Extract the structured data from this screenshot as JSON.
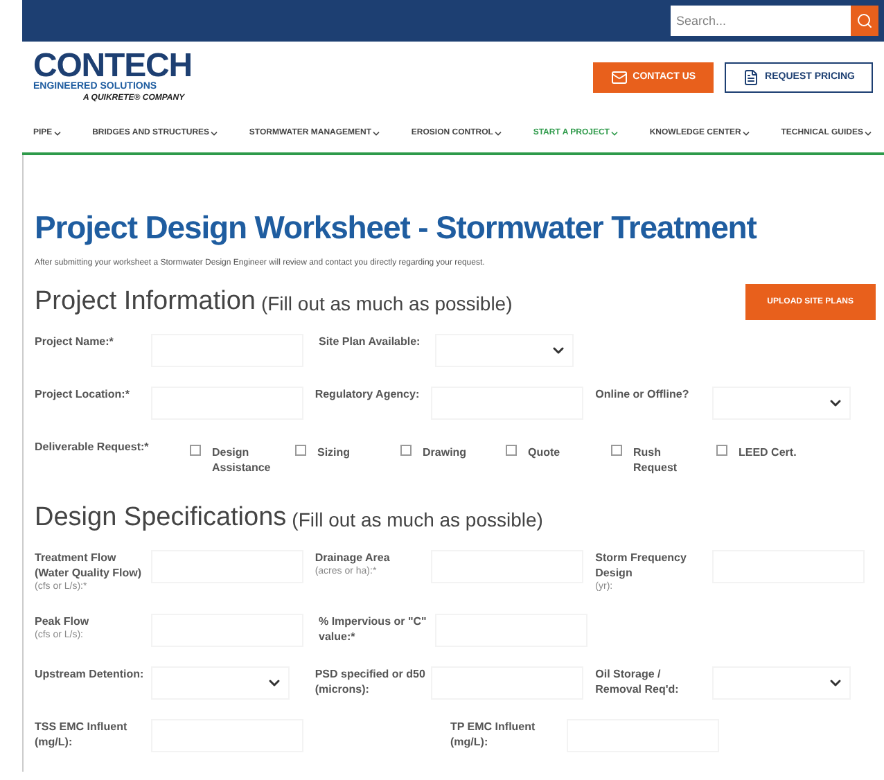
{
  "topbar": {
    "search": {
      "placeholder": "Search..."
    }
  },
  "logo": {
    "name": "CONTECH",
    "subtitle": "ENGINEERED SOLUTIONS",
    "tagline": "A QUIKRETE® COMPANY"
  },
  "header_buttons": [
    {
      "label": "CONTACT US",
      "kind": "primary"
    },
    {
      "label": "REQUEST PRICING",
      "kind": "outline"
    }
  ],
  "nav": [
    {
      "label": "PIPE",
      "selected": false
    },
    {
      "label": "BRIDGES AND STRUCTURES",
      "selected": false
    },
    {
      "label": "STORMWATER MANAGEMENT",
      "selected": false
    },
    {
      "label": "EROSION CONTROL",
      "selected": false
    },
    {
      "label": "START A PROJECT",
      "selected": true
    },
    {
      "label": "KNOWLEDGE CENTER",
      "selected": false
    },
    {
      "label": "TECHNICAL GUIDES",
      "selected": false
    }
  ],
  "title": "Project Design Worksheet - Stormwater Treatment",
  "intro": "After submitting your worksheet a Stormwater Design Engineer will review and contact you directly regarding your request.",
  "sections": [
    {
      "title": "Project Information",
      "note": "(Fill out as much as possible)",
      "button": "UPLOAD SITE PLANS",
      "rows": [
        [
          {
            "kind": "text",
            "label": "Project Name:*"
          },
          {
            "kind": "select",
            "label": "Site Plan Available:"
          }
        ],
        [
          {
            "kind": "text",
            "label": "Project Location:*"
          },
          {
            "kind": "text",
            "label": "Regulatory Agency:"
          },
          {
            "kind": "select",
            "label": "Online or Offline?"
          }
        ],
        [
          {
            "kind": "checkboxes",
            "label": "Deliverable Request:*",
            "options": [
              {
                "label": "Design Assistance",
                "checked": false
              },
              {
                "label": "Sizing",
                "checked": false
              },
              {
                "label": "Drawing",
                "checked": false
              },
              {
                "label": "Quote",
                "checked": false
              },
              {
                "label": "Rush Request",
                "checked": false
              },
              {
                "label": "LEED Cert.",
                "checked": false
              }
            ]
          }
        ]
      ]
    },
    {
      "title": "Design Specifications",
      "note": "(Fill out as much as possible)",
      "rows": [
        [
          {
            "kind": "text",
            "label": "Treatment Flow (Water Quality Flow)",
            "hint": "(cfs or L/s):*"
          },
          {
            "kind": "text",
            "label": "Drainage Area",
            "hint": "(acres or ha):*"
          },
          {
            "kind": "text",
            "label": "Storm Frequency Design",
            "hint": "(yr):"
          }
        ],
        [
          {
            "kind": "text",
            "label": "Peak Flow",
            "hint": "(cfs or L/s):"
          },
          {
            "kind": "text",
            "label": "% Impervious or \"C\" value:*"
          }
        ],
        [
          {
            "kind": "select",
            "label": "Upstream Detention:"
          },
          {
            "kind": "text",
            "label": "PSD specified or d50 (microns):"
          },
          {
            "kind": "select",
            "label": "Oil Storage / Removal Req'd:"
          }
        ],
        [
          {
            "kind": "text",
            "label": "TSS EMC Influent (mg/L):"
          },
          {
            "kind": "text",
            "label": "TP EMC Influent (mg/L):"
          }
        ]
      ]
    }
  ]
}
